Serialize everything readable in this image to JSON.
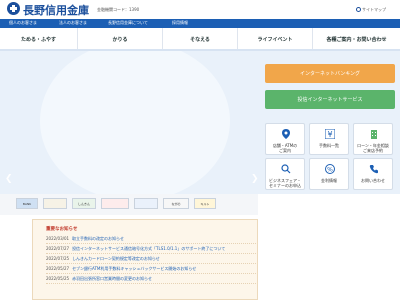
{
  "header": {
    "logo_text": "長野信用金庫",
    "bank_code": "金融機関コード：1390",
    "sitemap": "サイトマップ"
  },
  "topnav": {
    "items": [
      "個人のお客さま",
      "法人のお客さま",
      "長野信用金庫について",
      "採用情報"
    ]
  },
  "mainnav": {
    "items": [
      "ためる・ふやす",
      "かりる",
      "そなえる",
      "ライフイベント",
      "各種ご案内・お問い合わせ"
    ]
  },
  "hero": {
    "prev_icon": "chevron-left-icon",
    "next_icon": "chevron-right-icon"
  },
  "right_panel": {
    "internet_banking": "インターネットバンキング",
    "investment_service": "投信インターネットサービス",
    "tiles": [
      {
        "label": "店舗・ATMの\nご案内",
        "icon": "map-pin-icon"
      },
      {
        "label": "手数料一覧",
        "icon": "yen-icon"
      },
      {
        "label": "ローン・年金相談\nご来店予約",
        "icon": "building-icon"
      },
      {
        "label": "ビジネスフェア・\nセミナーのお申込",
        "icon": "search-people-icon"
      },
      {
        "label": "金利情報",
        "icon": "percent-icon"
      },
      {
        "label": "お問い合わせ",
        "icon": "phone-icon"
      }
    ]
  },
  "banners": {
    "items": [
      {
        "text": "BANK"
      },
      {
        "text": ""
      },
      {
        "text": "しんきん"
      },
      {
        "text": ""
      },
      {
        "text": ""
      },
      {
        "text": "ながの"
      },
      {
        "text": "キルト"
      }
    ]
  },
  "notices": {
    "title": "重要なお知らせ",
    "items": [
      {
        "date": "2022/03/01",
        "text": "取立手数料の改定のお知らせ"
      },
      {
        "date": "2022/07/27",
        "text": "投信インターネットサービス通信暗号化方式「TLS1.0/1.1」のサポート終了について"
      },
      {
        "date": "2022/07/25",
        "text": "しんきんカードローン契約規定等改定のお知らせ"
      },
      {
        "date": "2022/05/27",
        "text": "セブン銀行ATM利用手数料キャッシュバックサービス開始のお知らせ"
      },
      {
        "date": "2022/05/25",
        "text": "赤羽田出張所窓口営業時間の変更のお知らせ"
      }
    ]
  },
  "colors": {
    "brand": "#1b4f9c",
    "nav": "#1c5fb4",
    "internet_banking": "#f1a64a",
    "investment": "#5bb46b"
  }
}
